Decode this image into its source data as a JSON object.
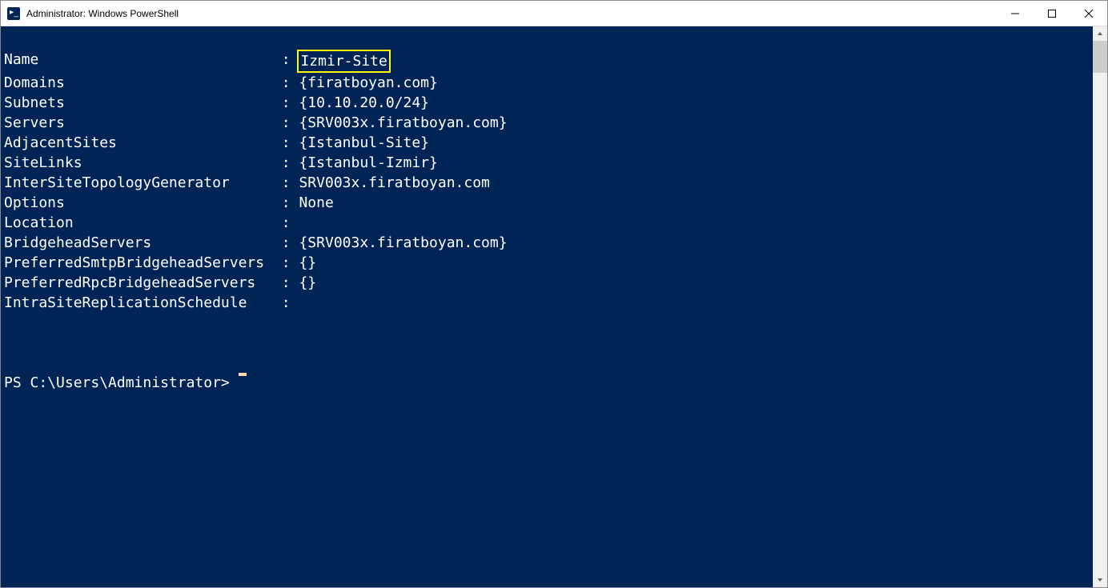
{
  "titlebar": {
    "title": "Administrator: Windows PowerShell"
  },
  "output": {
    "separator": " : ",
    "rows": [
      {
        "key": "Name",
        "value": "Izmir-Site",
        "highlighted": true
      },
      {
        "key": "Domains",
        "value": "{firatboyan.com}"
      },
      {
        "key": "Subnets",
        "value": "{10.10.20.0/24}"
      },
      {
        "key": "Servers",
        "value": "{SRV003x.firatboyan.com}"
      },
      {
        "key": "AdjacentSites",
        "value": "{Istanbul-Site}"
      },
      {
        "key": "SiteLinks",
        "value": "{Istanbul-Izmir}"
      },
      {
        "key": "InterSiteTopologyGenerator",
        "value": "SRV003x.firatboyan.com"
      },
      {
        "key": "Options",
        "value": "None"
      },
      {
        "key": "Location",
        "value": ""
      },
      {
        "key": "BridgeheadServers",
        "value": "{SRV003x.firatboyan.com}"
      },
      {
        "key": "PreferredSmtpBridgeheadServers",
        "value": "{}"
      },
      {
        "key": "PreferredRpcBridgeheadServers",
        "value": "{}"
      },
      {
        "key": "IntraSiteReplicationSchedule",
        "value": ""
      }
    ],
    "keyWidth": 31
  },
  "prompt": "PS C:\\Users\\Administrator> "
}
